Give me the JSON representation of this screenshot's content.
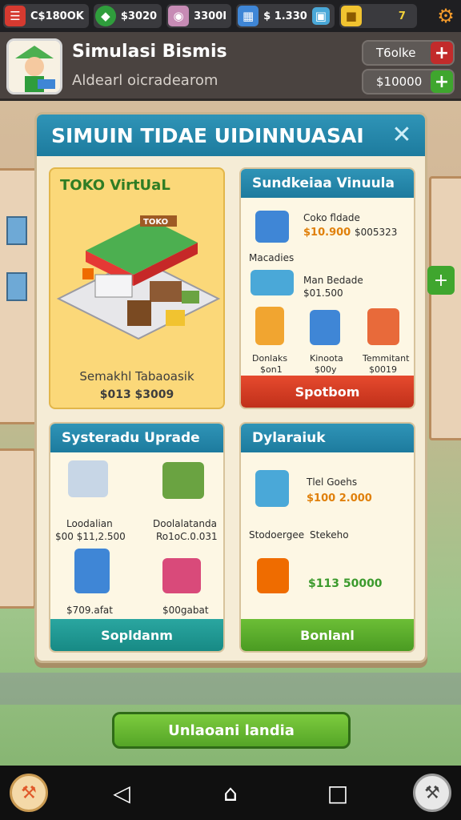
{
  "topbar": {
    "res1": {
      "icon": "book-icon",
      "value": "C$180OK"
    },
    "res2": {
      "icon": "gem-icon",
      "value": "$3020"
    },
    "res3": {
      "icon": "bag-icon",
      "value": "3300I"
    },
    "res4": {
      "icon": "crate-icon",
      "value": "$ 1.330"
    },
    "res5": {
      "icon": "gold-block-icon",
      "value": "7"
    },
    "settings_icon": "gear-icon"
  },
  "header": {
    "game_name": "Simulasi Bismis",
    "subtitle": "Aldearl oicradearom",
    "btn1_label": "T6olke",
    "btn2_label": "$10000"
  },
  "modal": {
    "title": "SIMUIN TIDAE UIDINNUASAI",
    "store_panel": {
      "title": "TOKO VirtUaL",
      "sign": "TOKO",
      "caption": "Semakhl Tabaoasik",
      "price": "$013 $3009"
    },
    "sim_panel": {
      "title": "Sundkeiaa Vinuula",
      "item1_name": "Coko fldade",
      "item1_price": "$10.900",
      "item1_price2": "$005323",
      "section_label": "Macadies",
      "item2_name": "Man Bedade",
      "item2_price": "$01.500",
      "tiles": [
        {
          "name": "Donlaks",
          "price": "$on1"
        },
        {
          "name": "Kinoota",
          "price": "$00y"
        },
        {
          "name": "Temmitant",
          "price": "$0019"
        }
      ],
      "button": "Spotbom"
    },
    "upgrade_panel": {
      "title": "Systeradu Uprade",
      "items": [
        {
          "name": "Loodalian",
          "price": "$00 $11,2.500"
        },
        {
          "name": "Doolalatanda",
          "price": "Ro1oC.0.031"
        },
        {
          "name": "",
          "price": "$709.afat"
        },
        {
          "name": "",
          "price": "$00gabat"
        }
      ],
      "button": "Sopldanm"
    },
    "dyl_panel": {
      "title": "Dylaraiuk",
      "item1_name": "Tlel Goehs",
      "item1_price": "$100 2.000",
      "row_label": "Stodoergee",
      "row_label2": "Stekeho",
      "item2_price": "$113 50000",
      "button": "Bonlanl"
    }
  },
  "bottom_button": "Unlaoani landia"
}
